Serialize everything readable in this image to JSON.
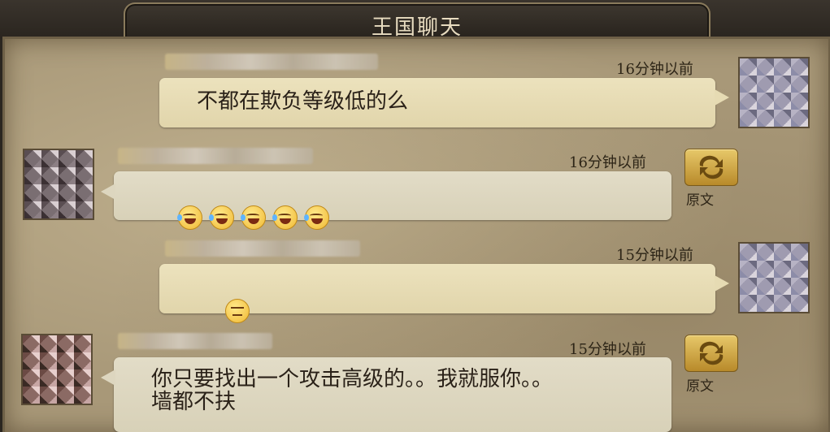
{
  "window": {
    "title": "王国聊天"
  },
  "messages": [
    {
      "side": "right",
      "time": "16分钟以前",
      "text": "不都在欺负等级低的么"
    },
    {
      "side": "left",
      "time": "16分钟以前",
      "emojis": [
        "laugh-cry",
        "laugh-cry",
        "laugh-cry",
        "laugh-cry",
        "laugh-cry"
      ],
      "translate_label": "原文"
    },
    {
      "side": "right",
      "time": "15分钟以前",
      "emojis": [
        "expressionless"
      ]
    },
    {
      "side": "left",
      "time": "15分钟以前",
      "text": "你只要找出一个攻击高级的。。我就服你。。\n墙都不扶",
      "translate_label": "原文"
    }
  ],
  "colors": {
    "own_bubble": "#e6dbb3",
    "other_bubble": "#ddd6bf",
    "panel": "#a89878",
    "translate_button": "#d4a94a"
  },
  "icons": {
    "translate": "translate-arrows-icon"
  }
}
